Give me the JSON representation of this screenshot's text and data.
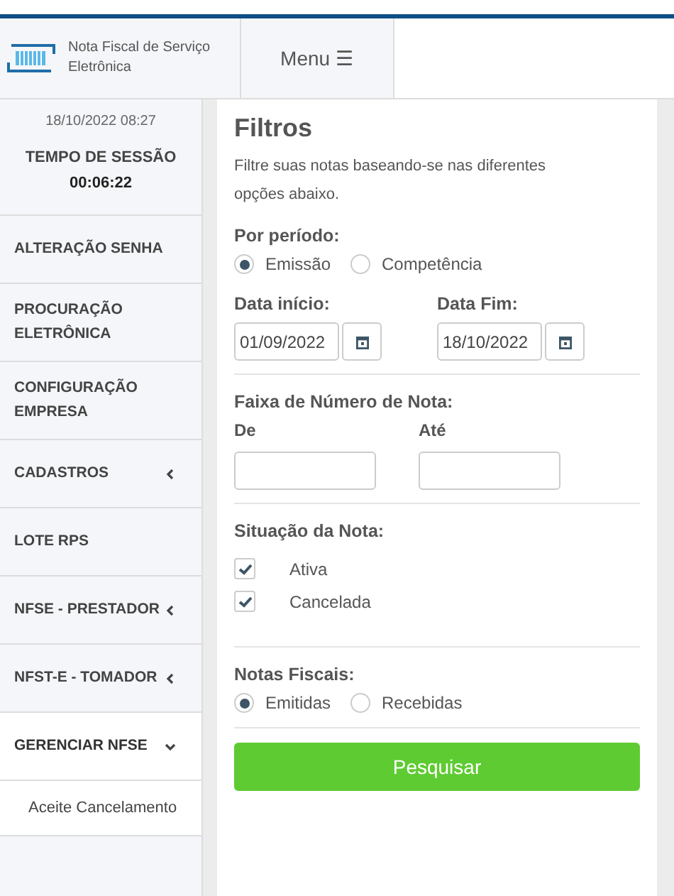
{
  "header": {
    "logo_text": "Nota Fiscal de Serviço Eletrônica",
    "menu_button": "Menu ☰"
  },
  "sidebar": {
    "last_access": "18/10/2022 08:27",
    "session_label": "TEMPO DE SESSÃO",
    "session_time": "00:06:22",
    "items": [
      {
        "label": "ALTERAÇÃO SENHA"
      },
      {
        "label": "PROCURAÇÃO ELETRÔNICA"
      },
      {
        "label": "CONFIGURAÇÃO EMPRESA"
      },
      {
        "label": "CADASTROS",
        "expanded": false
      },
      {
        "label": "LOTE RPS"
      },
      {
        "label": "NFSE - PRESTADOR",
        "expanded": false
      },
      {
        "label": "NFST-E - TOMADOR",
        "expanded": false
      },
      {
        "label": "GERENCIAR NFSE",
        "expanded": true,
        "children": [
          {
            "label": "Aceite Cancelamento"
          }
        ]
      }
    ]
  },
  "filters": {
    "title": "Filtros",
    "description": "Filtre suas notas baseando-se nas diferentes opções abaixo.",
    "period": {
      "label": "Por período:",
      "options": [
        {
          "label": "Emissão",
          "selected": true
        },
        {
          "label": "Competência",
          "selected": false
        }
      ]
    },
    "dates": [
      {
        "label": "Data início:",
        "value": "01/09/2022"
      },
      {
        "label": "Data Fim:",
        "value": "18/10/2022"
      }
    ],
    "number_range": {
      "label": "Faixa de Número de Nota:",
      "fields": [
        {
          "label": "De"
        },
        {
          "label": "Até"
        }
      ]
    },
    "status": {
      "label": "Situação da Nota:",
      "options": [
        {
          "label": "Ativa",
          "checked": true
        },
        {
          "label": "Cancelada",
          "checked": true
        }
      ]
    },
    "notes": {
      "label": "Notas Fiscais:",
      "options": [
        {
          "label": "Emitidas",
          "selected": true
        },
        {
          "label": "Recebidas",
          "selected": false
        }
      ]
    },
    "search_button": "Pesquisar"
  }
}
